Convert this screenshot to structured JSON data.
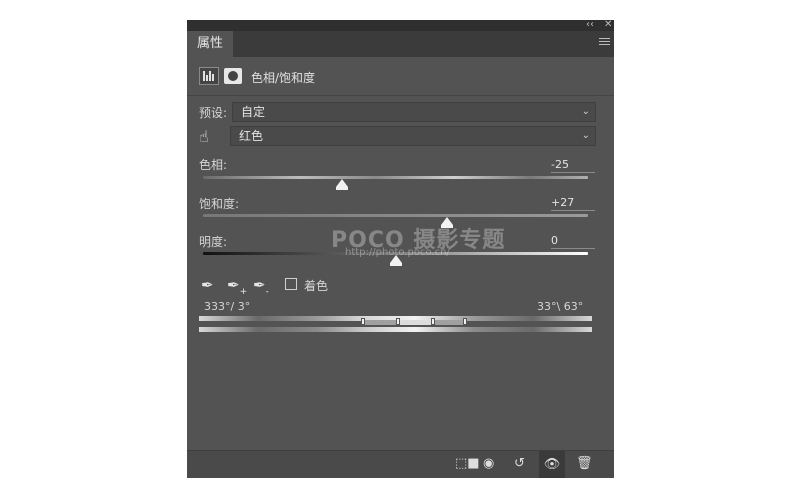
{
  "panel": {
    "tab_label": "属性",
    "title": "色相/饱和度",
    "collapse_icon": "‹‹",
    "close_icon": "✕"
  },
  "preset": {
    "label": "预设:",
    "value": "自定"
  },
  "channel": {
    "value": "红色"
  },
  "hue": {
    "label": "色相:",
    "value": "-25",
    "fraction": 0.36
  },
  "saturation": {
    "label": "饱和度:",
    "value": "+27",
    "fraction": 0.635
  },
  "lightness": {
    "label": "明度:",
    "value": "0",
    "fraction": 0.5
  },
  "colorize": {
    "label": "着色",
    "checked": false
  },
  "range": {
    "left_label": "333°/ 3°",
    "right_label": "33°\\ 63°"
  },
  "watermark": {
    "brand": "POCO 摄影专题",
    "url": "http://photo.poco.cn/"
  },
  "colors": {
    "panel_bg": "#535353",
    "tab_bar": "#3b3b3b",
    "title_bar": "#2f2f2f"
  }
}
